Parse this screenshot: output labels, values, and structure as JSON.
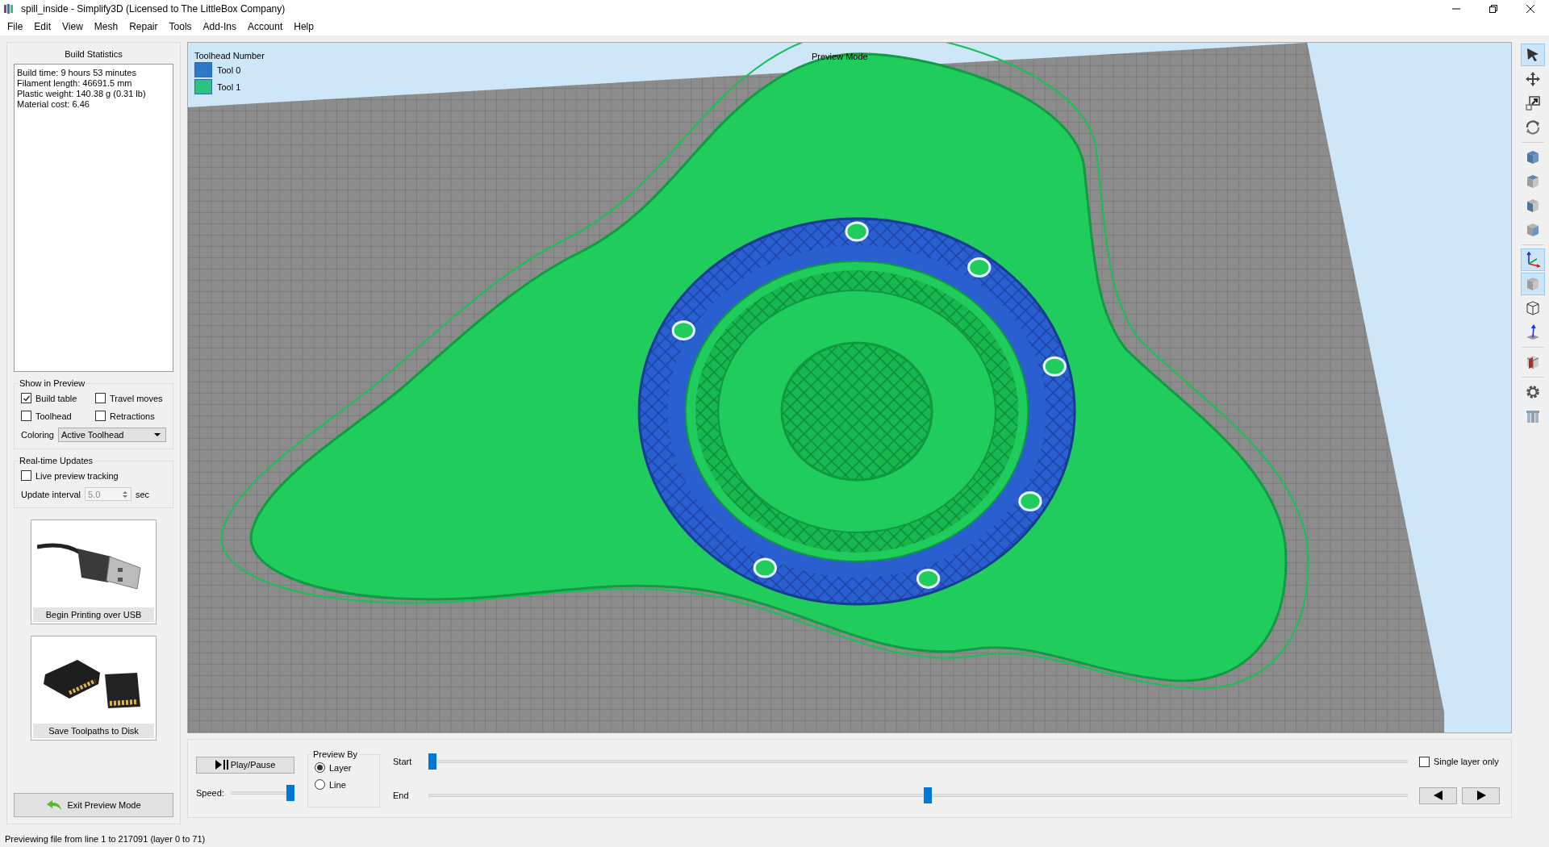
{
  "window": {
    "title": "spill_inside - Simplify3D (Licensed to The LittleBox Company)"
  },
  "menu": [
    "File",
    "Edit",
    "View",
    "Mesh",
    "Repair",
    "Tools",
    "Add-Ins",
    "Account",
    "Help"
  ],
  "build_statistics": {
    "title": "Build Statistics",
    "lines": [
      "Build time: 9 hours 53 minutes",
      "Filament length: 46691.5 mm",
      "Plastic weight: 140.38 g (0.31 lb)",
      "Material cost: 6.46"
    ]
  },
  "show_in_preview": {
    "title": "Show in Preview",
    "options": [
      {
        "label": "Build table",
        "checked": true
      },
      {
        "label": "Travel moves",
        "checked": false
      },
      {
        "label": "Toolhead",
        "checked": false
      },
      {
        "label": "Retractions",
        "checked": false
      }
    ],
    "coloring": {
      "label": "Coloring",
      "value": "Active Toolhead"
    }
  },
  "realtime_updates": {
    "title": "Real-time Updates",
    "live_tracking": {
      "label": "Live preview tracking",
      "checked": false
    },
    "update_interval": {
      "label": "Update interval",
      "value": "5.0",
      "unit": "sec",
      "disabled": true
    }
  },
  "actions": [
    {
      "kind": "usb",
      "label": "Begin Printing over USB"
    },
    {
      "kind": "sd",
      "label": "Save Toolpaths to Disk"
    }
  ],
  "exit_button": {
    "label": "Exit Preview Mode"
  },
  "viewport": {
    "legend_title": "Toolhead Number",
    "legend": [
      {
        "label": "Tool 0",
        "color": "#2f78c8"
      },
      {
        "label": "Tool 1",
        "color": "#2ec27e"
      }
    ],
    "mode_label": "Preview Mode"
  },
  "toolbar": [
    [
      {
        "kind": "select",
        "selected": true
      },
      {
        "kind": "move",
        "selected": false
      },
      {
        "kind": "scale",
        "selected": false
      },
      {
        "kind": "rotate",
        "selected": false
      }
    ],
    [
      {
        "kind": "view-iso",
        "selected": false
      },
      {
        "kind": "view-top",
        "selected": false
      },
      {
        "kind": "view-front",
        "selected": false
      },
      {
        "kind": "view-side",
        "selected": false
      }
    ],
    [
      {
        "kind": "axes",
        "selected": true
      },
      {
        "kind": "solid",
        "selected": true
      },
      {
        "kind": "wireframe",
        "selected": false
      },
      {
        "kind": "normals",
        "selected": false
      }
    ],
    [
      {
        "kind": "section",
        "selected": false
      }
    ],
    [
      {
        "kind": "settings",
        "selected": false
      },
      {
        "kind": "supports",
        "selected": false
      }
    ]
  ],
  "playback": {
    "play_label": "Play/Pause",
    "speed_label": "Speed:",
    "speed": {
      "level": 1
    },
    "preview_by": {
      "title": "Preview By",
      "options": [
        {
          "label": "Layer",
          "selected": true
        },
        {
          "label": "Line",
          "selected": false
        }
      ]
    },
    "start": {
      "label": "Start",
      "level": 0
    },
    "end": {
      "label": "End",
      "level": 0.51
    },
    "single_layer": {
      "label": "Single layer only",
      "checked": false
    }
  },
  "status_bar": "Previewing file from line 1 to 217091 (layer 0 to 71)"
}
